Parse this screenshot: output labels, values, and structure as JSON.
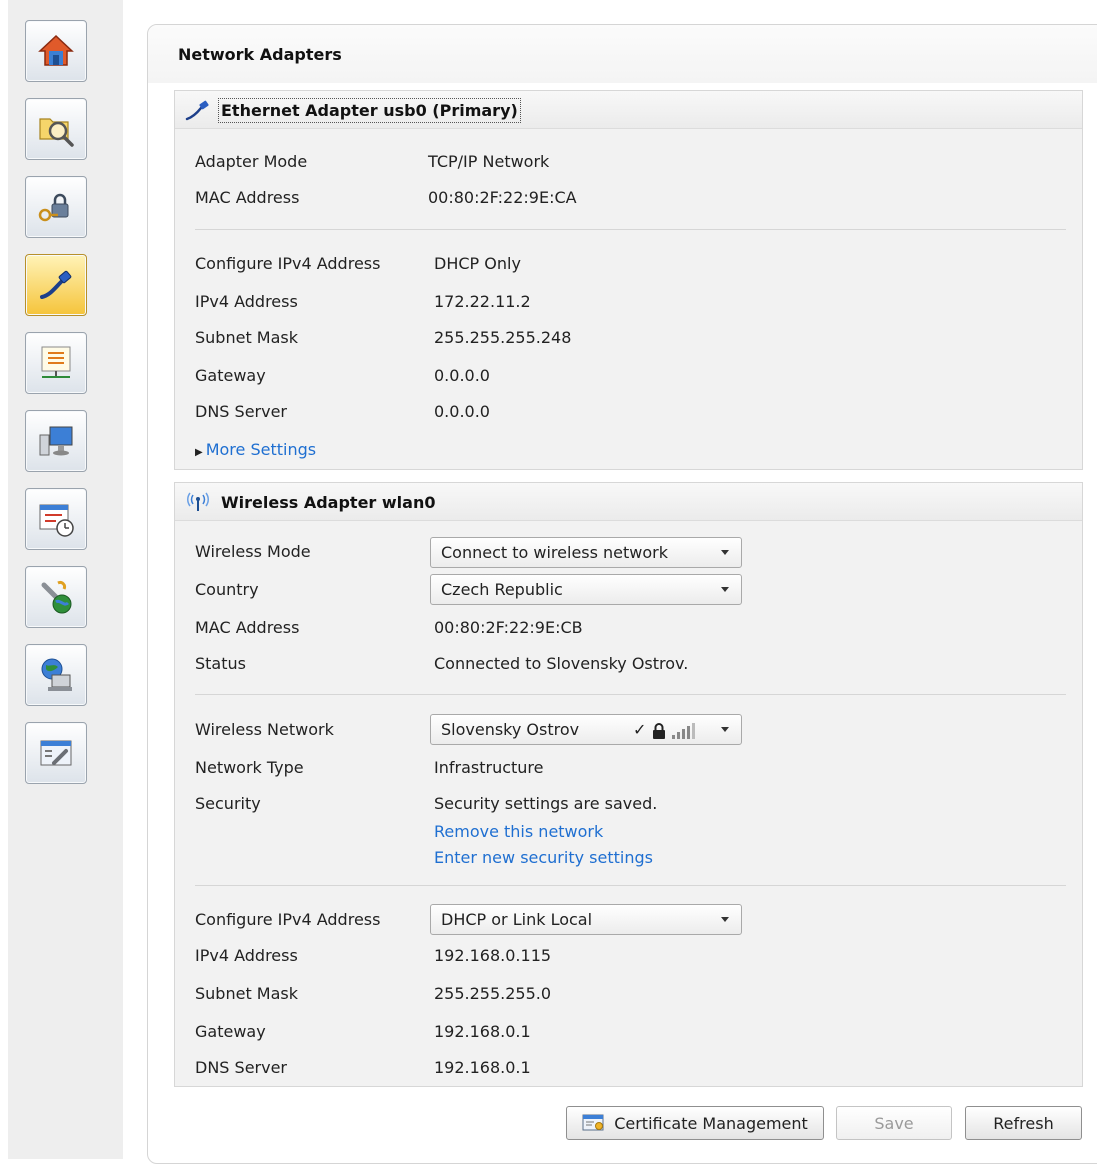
{
  "nav": {
    "items": [
      {
        "name": "home"
      },
      {
        "name": "search-folder"
      },
      {
        "name": "security-lock"
      },
      {
        "name": "network-cable",
        "active": true
      },
      {
        "name": "list-network"
      },
      {
        "name": "computer-display"
      },
      {
        "name": "schedule-clock"
      },
      {
        "name": "tools-globe"
      },
      {
        "name": "globe-computer"
      },
      {
        "name": "config-tool"
      }
    ]
  },
  "panel": {
    "title": "Network Adapters"
  },
  "ethernet": {
    "title": "Ethernet Adapter usb0 (Primary)",
    "adapter_mode_label": "Adapter Mode",
    "adapter_mode_value": "TCP/IP Network",
    "mac_label": "MAC Address",
    "mac_value": "00:80:2F:22:9E:CA",
    "config_ipv4_label": "Configure IPv4 Address",
    "config_ipv4_value": "DHCP Only",
    "ipv4_label": "IPv4 Address",
    "ipv4_value": "172.22.11.2",
    "subnet_label": "Subnet Mask",
    "subnet_value": "255.255.255.248",
    "gateway_label": "Gateway",
    "gateway_value": "0.0.0.0",
    "dns_label": "DNS Server",
    "dns_value": "0.0.0.0",
    "more_settings": "More Settings"
  },
  "wireless": {
    "title": "Wireless Adapter wlan0",
    "mode_label": "Wireless Mode",
    "mode_value": "Connect to wireless network",
    "country_label": "Country",
    "country_value": "Czech Republic",
    "mac_label": "MAC Address",
    "mac_value": "00:80:2F:22:9E:CB",
    "status_label": "Status",
    "status_value": "Connected to Slovensky Ostrov.",
    "network_label": "Wireless Network",
    "network_value": "Slovensky Ostrov",
    "network_check": "✓",
    "network_type_label": "Network Type",
    "network_type_value": "Infrastructure",
    "security_label": "Security",
    "security_value": "Security settings are saved.",
    "remove_link": "Remove this network",
    "enter_link": "Enter new security settings",
    "config_ipv4_label": "Configure IPv4 Address",
    "config_ipv4_value": "DHCP or Link Local",
    "ipv4_label": "IPv4 Address",
    "ipv4_value": "192.168.0.115",
    "subnet_label": "Subnet Mask",
    "subnet_value": "255.255.255.0",
    "gateway_label": "Gateway",
    "gateway_value": "192.168.0.1",
    "dns_label": "DNS Server",
    "dns_value": "192.168.0.1"
  },
  "buttons": {
    "cert_label": "Certificate Management",
    "save_label": "Save",
    "save_disabled": true,
    "refresh_label": "Refresh"
  },
  "colors": {
    "link": "#1f6fd1",
    "active_nav": "#f5c43a"
  }
}
